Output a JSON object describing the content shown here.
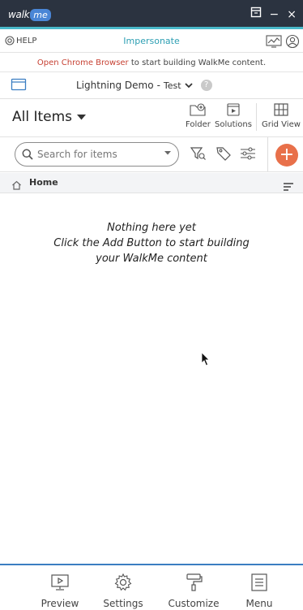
{
  "titlebar": {
    "logo_walk": "walk",
    "logo_me": "me",
    "minimize": "−",
    "close": "×"
  },
  "helpbar": {
    "help_label": "HELP",
    "impersonate_label": "Impersonate"
  },
  "notice": {
    "link_text": "Open Chrome Browser",
    "rest_text": " to start building WalkMe content."
  },
  "project": {
    "name": "Lightning Demo",
    "separator": "-",
    "environment": "Test",
    "help_glyph": "?"
  },
  "items": {
    "title": "All Items",
    "tools": [
      {
        "label": "Folder",
        "icon": "folder-add-icon"
      },
      {
        "label": "Solutions",
        "icon": "solutions-icon"
      },
      {
        "label": "Grid View",
        "icon": "grid-view-icon"
      }
    ]
  },
  "search": {
    "placeholder": "Search for items",
    "value": ""
  },
  "add_button": {
    "glyph": "+"
  },
  "breadcrumb": {
    "home_label": "Home"
  },
  "empty_state": {
    "line1": "Nothing here yet",
    "line2": "Click the Add Button to start building",
    "line3": "your WalkMe content"
  },
  "bottom_nav": [
    {
      "label": "Preview",
      "icon": "preview-icon"
    },
    {
      "label": "Settings",
      "icon": "gear-icon"
    },
    {
      "label": "Customize",
      "icon": "paint-roller-icon"
    },
    {
      "label": "Menu",
      "icon": "menu-icon"
    }
  ],
  "colors": {
    "titlebar": "#2b3340",
    "accent": "#49b8c9",
    "link_red": "#c74234",
    "add_orange": "#e8704a",
    "bottom_border": "#3b7ec2"
  }
}
